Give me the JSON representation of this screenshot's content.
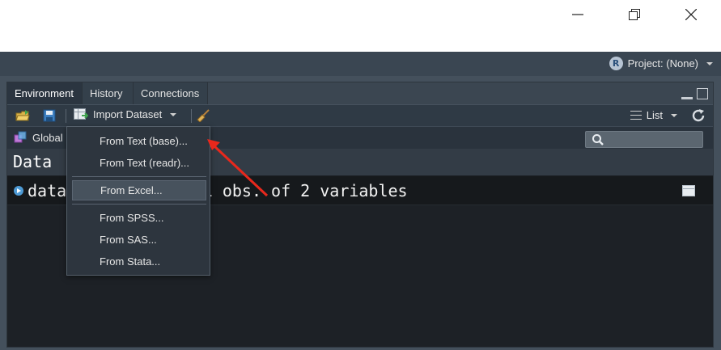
{
  "window": {
    "controls": [
      "minimize",
      "maximize",
      "close"
    ]
  },
  "project": {
    "label": "Project: (None)",
    "badge": "R"
  },
  "tabs": [
    {
      "label": "Environment",
      "active": true
    },
    {
      "label": "History",
      "active": false
    },
    {
      "label": "Connections",
      "active": false
    }
  ],
  "toolbar": {
    "import_label": "Import Dataset",
    "list_label": "List"
  },
  "env": {
    "scope_label": "Global",
    "search_placeholder": ""
  },
  "data_section": {
    "header": "Data",
    "rows": [
      {
        "text": "data          74961 obs. of 2 variables"
      }
    ]
  },
  "import_menu": {
    "items": [
      {
        "label": "From Text (base)..."
      },
      {
        "label": "From Text (readr)..."
      },
      {
        "label": "From Excel...",
        "highlighted": true
      },
      {
        "label": "From SPSS..."
      },
      {
        "label": "From SAS..."
      },
      {
        "label": "From Stata..."
      }
    ]
  },
  "colors": {
    "pane_bg": "#1d2126",
    "toolbar_bg": "#2f3a45",
    "menu_bg": "#2d353e",
    "annotation": "#e8281c",
    "expand_icon": "#4e9bd6"
  }
}
